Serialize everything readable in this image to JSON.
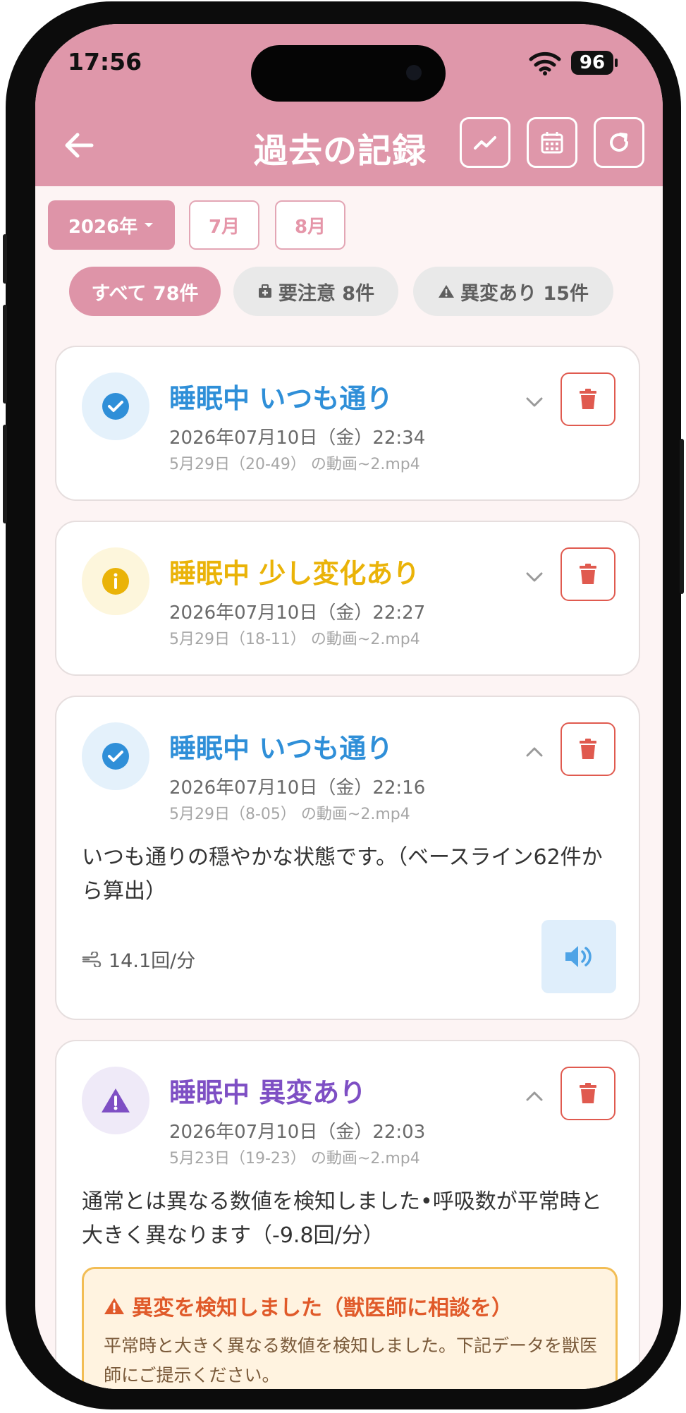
{
  "status_bar": {
    "time": "17:56",
    "battery": "96"
  },
  "header": {
    "title": "過去の記録"
  },
  "date_filter": {
    "year": "2026年",
    "months": [
      "7月",
      "8月"
    ]
  },
  "filters": [
    {
      "label": "すべて 78件",
      "active": true
    },
    {
      "label": "要注意 8件",
      "icon": "medical-bag-icon",
      "active": false
    },
    {
      "label": "異変あり 15件",
      "icon": "warning-icon",
      "active": false
    }
  ],
  "records": [
    {
      "status": "normal",
      "title": "睡眠中 いつも通り",
      "title_color": "#2f8fd8",
      "datetime": "2026年07月10日（金）22:34",
      "file": "5月29日（20-49） の動画~2.mp4",
      "expanded": false
    },
    {
      "status": "info",
      "title": "睡眠中 少し変化あり",
      "title_color": "#eab308",
      "datetime": "2026年07月10日（金）22:27",
      "file": "5月29日（18-11） の動画~2.mp4",
      "expanded": false
    },
    {
      "status": "normal",
      "title": "睡眠中 いつも通り",
      "title_color": "#2f8fd8",
      "datetime": "2026年07月10日（金）22:16",
      "file": "5月29日（8-05） の動画~2.mp4",
      "expanded": true,
      "description": "いつも通りの穏やかな状態です。（ベースライン62件から算出）",
      "metric": "14.1回/分"
    },
    {
      "status": "warning",
      "title": "睡眠中 異変あり",
      "title_color": "#7e4fc4",
      "datetime": "2026年07月10日（金）22:03",
      "file": "5月23日（19-23） の動画~2.mp4",
      "expanded": true,
      "description": "通常とは異なる数値を検知しました•呼吸数が平常時と大きく異なります（-9.8回/分）",
      "alert": {
        "title": "異変を検知しました（獣医師に相談を）",
        "text": "平常時と大きく異なる数値を検知しました。下記データを獣医師にご提示ください。"
      }
    }
  ],
  "colors": {
    "header": "#df97aa",
    "accent": "#de94a8",
    "delete": "#e05a4f",
    "normal": "#2f8fd8",
    "info": "#eab308",
    "warning": "#7e4fc4"
  }
}
